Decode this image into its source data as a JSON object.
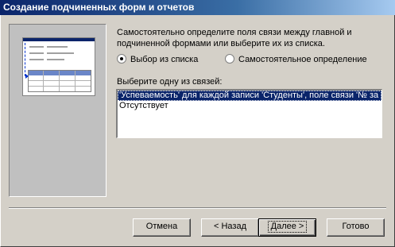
{
  "window": {
    "title": "Создание подчиненных форм и отчетов"
  },
  "description": "Самостоятельно определите поля связи между главной и подчиненной формами или выберите их из списка.",
  "options": {
    "from_list": "Выбор из списка",
    "custom": "Самостоятельное определение",
    "selected": "from_list"
  },
  "list": {
    "label": "Выберите одну из связей:",
    "items": [
      "'Успеваемость' для каждой записи 'Студенты', поле связи '№ за",
      "Отсутствует"
    ],
    "selected_index": 0
  },
  "buttons": {
    "cancel": "Отмена",
    "back": "< Назад",
    "next": "Далее >",
    "finish": "Готово"
  }
}
